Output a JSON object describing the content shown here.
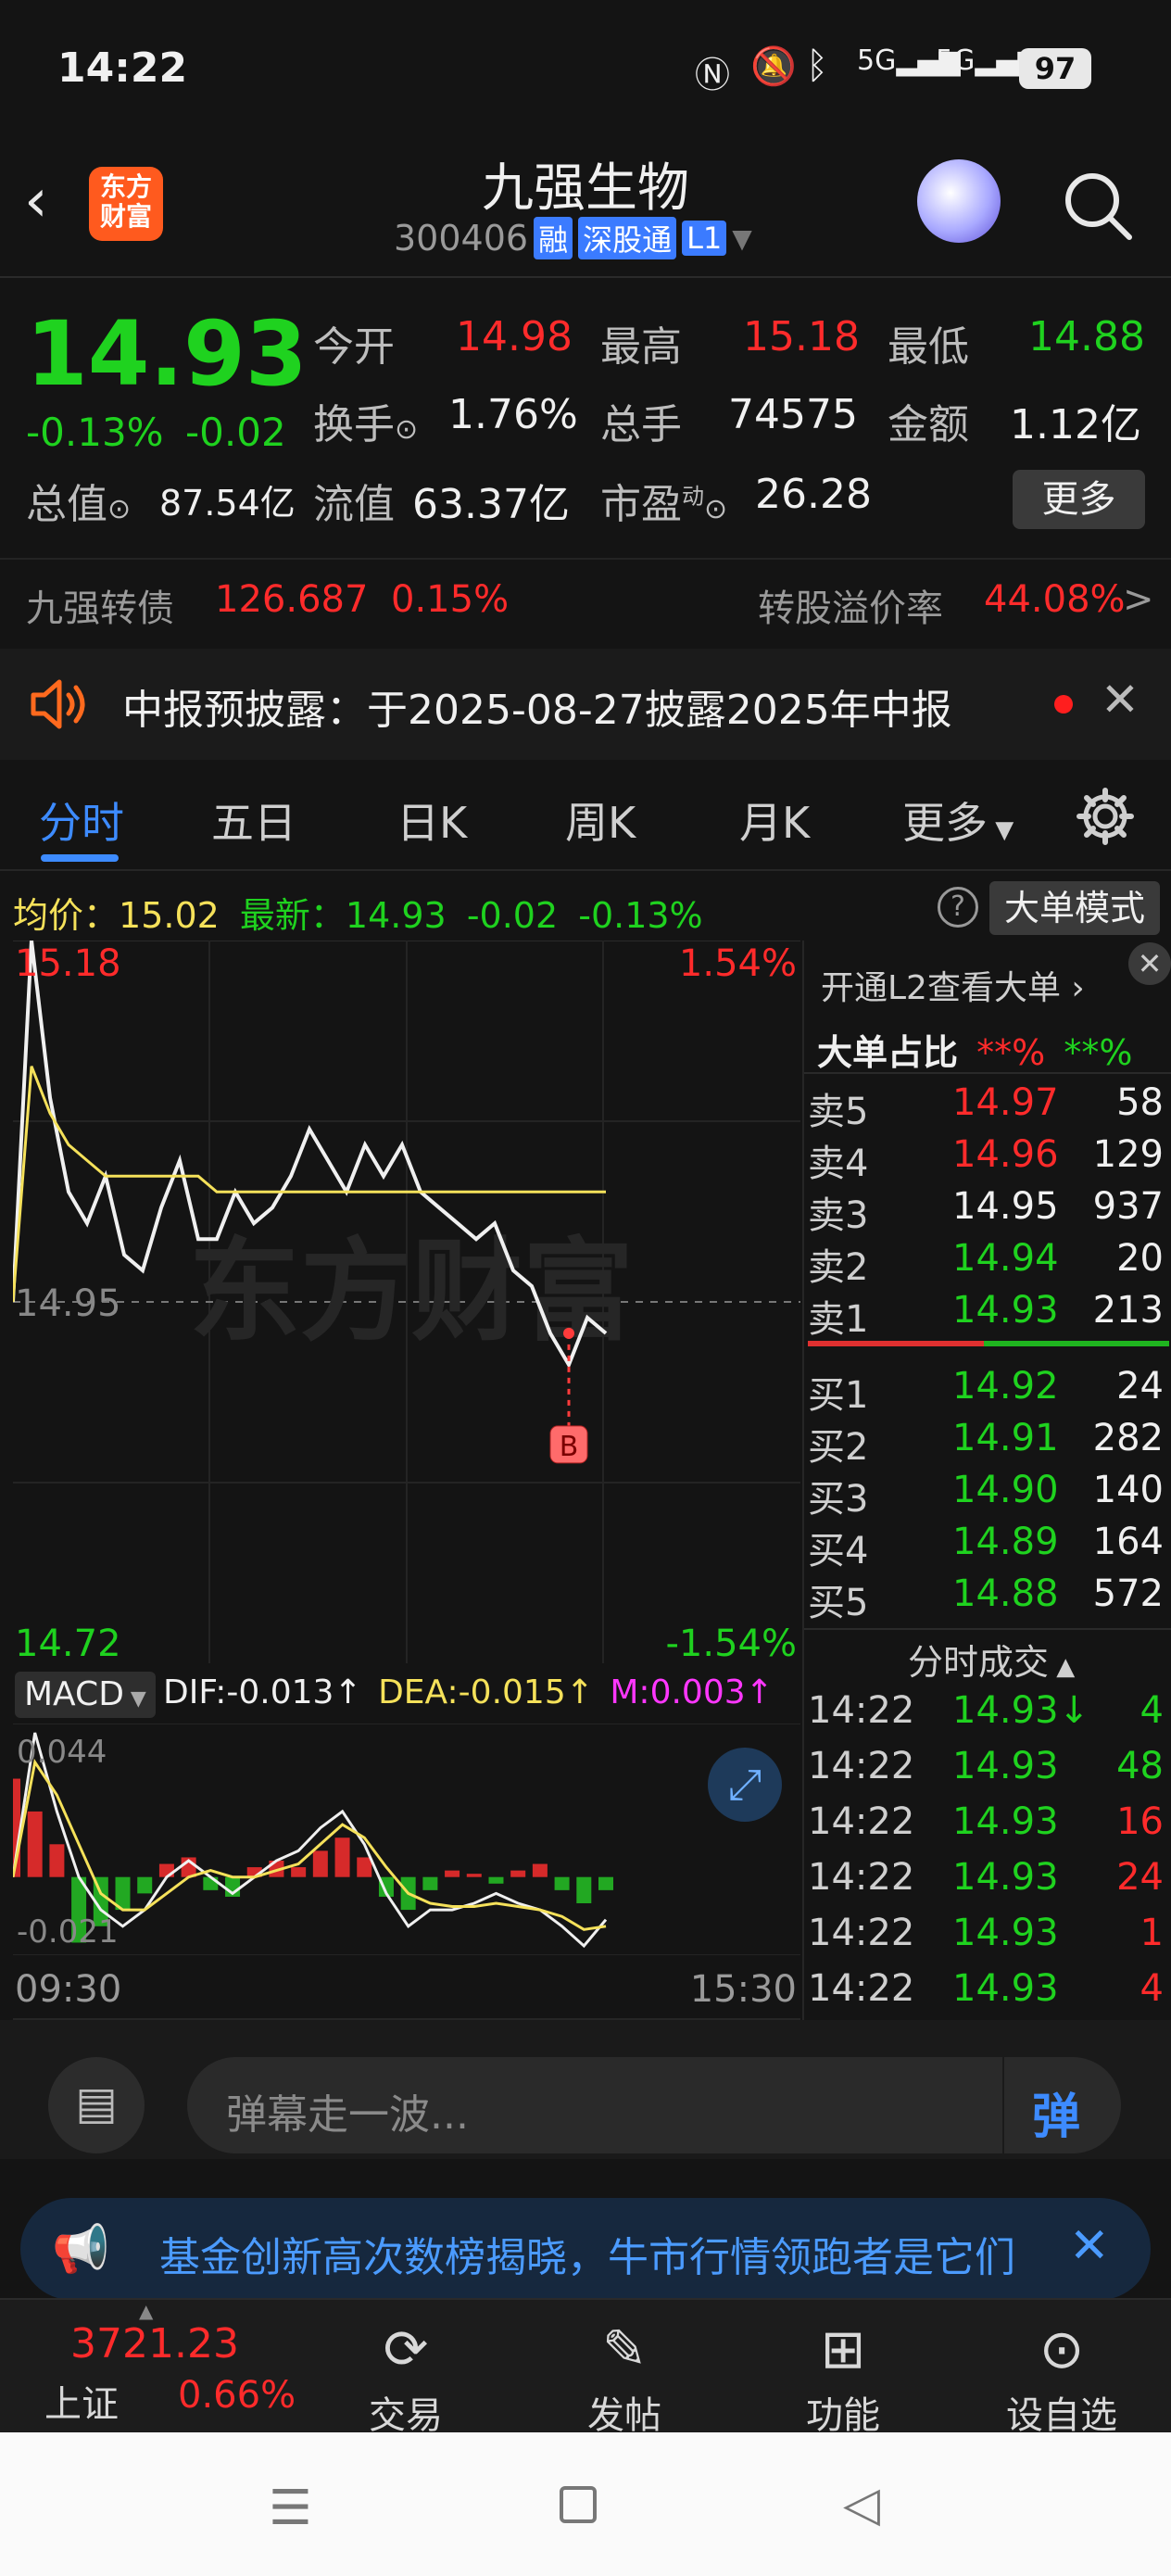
{
  "status": {
    "time": "14:22",
    "battery": "97",
    "net1": "5G",
    "net2": "5G"
  },
  "header": {
    "brand_line1": "东方",
    "brand_line2": "财富",
    "title": "九强生物",
    "code": "300406",
    "tag_rong": "融",
    "tag_connect": "深股通",
    "tag_level": "L1"
  },
  "quote": {
    "price": "14.93",
    "change_pct": "-0.13%",
    "change": "-0.02",
    "open_label": "今开",
    "open": "14.98",
    "high_label": "最高",
    "high": "15.18",
    "low_label": "最低",
    "low": "14.88",
    "turnover_label": "换手",
    "turnover": "1.76%",
    "volume_label": "总手",
    "volume": "74575",
    "amount_label": "金额",
    "amount": "1.12亿",
    "mktcap_label": "总值",
    "mktcap": "87.54亿",
    "float_label": "流值",
    "float": "63.37亿",
    "pe_label": "市盈",
    "pe_sup": "动",
    "pe": "26.28",
    "more": "更多"
  },
  "bond": {
    "name": "九强转债",
    "price": "126.687",
    "pct": "0.15%",
    "premium_label": "转股溢价率",
    "premium": "44.08%",
    "arrow": ">"
  },
  "notice": {
    "text": "中报预披露：于2025-08-27披露2025年中报"
  },
  "tabs": [
    {
      "label": "分时"
    },
    {
      "label": "五日"
    },
    {
      "label": "日K"
    },
    {
      "label": "周K"
    },
    {
      "label": "月K"
    },
    {
      "label": "更多"
    }
  ],
  "infobar": {
    "avg_label": "均价：",
    "avg": "15.02",
    "latest_label": "最新：",
    "latest": "14.93",
    "chg": "-0.02",
    "pct": "-0.13%",
    "bigorder": "大单模式"
  },
  "chart_data": [
    {
      "type": "line",
      "title": "",
      "x": [
        "09:30",
        "15:30"
      ],
      "y_range": [
        14.72,
        15.18
      ],
      "pct_range": [
        "-1.54%",
        "1.54%"
      ],
      "reference": 14.95,
      "series": [
        {
          "name": "最新",
          "color": "#f0f0f0",
          "values": [
            14.95,
            15.18,
            15.08,
            15.02,
            15.0,
            15.03,
            14.98,
            14.97,
            15.01,
            15.04,
            14.99,
            14.99,
            15.02,
            15.0,
            15.01,
            15.03,
            15.06,
            15.04,
            15.02,
            15.05,
            15.03,
            15.05,
            15.02,
            15.01,
            15.0,
            14.99,
            15.0,
            14.97,
            14.96,
            14.93,
            14.91,
            14.94,
            14.93
          ]
        },
        {
          "name": "均价",
          "color": "#f5e15a",
          "values": [
            14.95,
            15.1,
            15.07,
            15.05,
            15.04,
            15.03,
            15.03,
            15.03,
            15.03,
            15.03,
            15.03,
            15.02,
            15.02,
            15.02,
            15.02,
            15.02,
            15.02,
            15.02,
            15.02,
            15.02,
            15.02,
            15.02,
            15.02,
            15.02,
            15.02,
            15.02,
            15.02,
            15.02,
            15.02,
            15.02,
            15.02,
            15.02,
            15.02
          ]
        }
      ],
      "annotations": [
        {
          "label": "B",
          "value": 14.93
        }
      ],
      "top_left": "15.18",
      "top_right": "1.54%",
      "mid_left": "14.95",
      "bottom_left": "14.72",
      "bottom_right": "-1.54%",
      "x_start": "09:30",
      "x_end": "15:30"
    },
    {
      "type": "bar",
      "title": "",
      "indicator": "MACD",
      "dif": "-0.013",
      "dea": "-0.015",
      "m": "0.003",
      "y_range": [
        -0.021,
        0.044
      ],
      "top_label": "0.044",
      "bottom_label": "-0.021",
      "histogram": [
        0.03,
        0.02,
        0.01,
        -0.02,
        -0.015,
        -0.01,
        -0.005,
        0.004,
        0.006,
        -0.004,
        -0.006,
        0.003,
        0.005,
        0.003,
        0.008,
        0.012,
        0.006,
        -0.006,
        -0.01,
        -0.004,
        0.002,
        0.001,
        -0.002,
        0.002,
        0.004,
        -0.004,
        -0.008,
        -0.004
      ],
      "dif_values": [
        0.0,
        0.044,
        0.02,
        0.0,
        -0.01,
        -0.015,
        -0.01,
        0.0,
        0.005,
        0.0,
        -0.005,
        0.0,
        0.005,
        0.008,
        0.015,
        0.02,
        0.01,
        -0.005,
        -0.015,
        -0.01,
        -0.01,
        -0.008,
        -0.005,
        -0.008,
        -0.01,
        -0.015,
        -0.021,
        -0.013
      ],
      "dea_values": [
        0.0,
        0.035,
        0.025,
        0.01,
        -0.005,
        -0.01,
        -0.01,
        -0.005,
        0.0,
        0.002,
        0.0,
        0.0,
        0.002,
        0.004,
        0.01,
        0.016,
        0.012,
        0.003,
        -0.005,
        -0.008,
        -0.009,
        -0.009,
        -0.008,
        -0.009,
        -0.01,
        -0.012,
        -0.016,
        -0.015
      ]
    }
  ],
  "macd": {
    "name": "MACD",
    "dif_label": "DIF:",
    "dif": "-0.013",
    "dea_label": "DEA:",
    "dea": "-0.015",
    "m_label": "M:",
    "m": "0.003",
    "top": "0.044",
    "bottom": "-0.021",
    "x_start": "09:30",
    "x_end": "15:30"
  },
  "side": {
    "promo": "开通L2查看大单",
    "bigratio_label": "大单占比",
    "bigratio_sell": "**%",
    "bigratio_buy": "**%",
    "sells": [
      {
        "label": "卖5",
        "price": "14.97",
        "vol": "58",
        "color": "red"
      },
      {
        "label": "卖4",
        "price": "14.96",
        "vol": "129",
        "color": "red"
      },
      {
        "label": "卖3",
        "price": "14.95",
        "vol": "937",
        "color": "white"
      },
      {
        "label": "卖2",
        "price": "14.94",
        "vol": "20",
        "color": "green"
      },
      {
        "label": "卖1",
        "price": "14.93",
        "vol": "213",
        "color": "green"
      }
    ],
    "buys": [
      {
        "label": "买1",
        "price": "14.92",
        "vol": "24",
        "color": "green"
      },
      {
        "label": "买2",
        "price": "14.91",
        "vol": "282",
        "color": "green"
      },
      {
        "label": "买3",
        "price": "14.90",
        "vol": "140",
        "color": "green"
      },
      {
        "label": "买4",
        "price": "14.89",
        "vol": "164",
        "color": "green"
      },
      {
        "label": "买5",
        "price": "14.88",
        "vol": "572",
        "color": "green"
      }
    ],
    "trades_title": "分时成交",
    "trades": [
      {
        "time": "14:22",
        "price": "14.93",
        "arrow": "↓",
        "vol": "4",
        "color": "green"
      },
      {
        "time": "14:22",
        "price": "14.93",
        "arrow": "",
        "vol": "48",
        "color": "green"
      },
      {
        "time": "14:22",
        "price": "14.93",
        "arrow": "",
        "vol": "16",
        "color": "red"
      },
      {
        "time": "14:22",
        "price": "14.93",
        "arrow": "",
        "vol": "24",
        "color": "red"
      },
      {
        "time": "14:22",
        "price": "14.93",
        "arrow": "",
        "vol": "1",
        "color": "red"
      },
      {
        "time": "14:22",
        "price": "14.93",
        "arrow": "",
        "vol": "4",
        "color": "red"
      }
    ]
  },
  "comment": {
    "placeholder": "弹幕走一波...",
    "send": "弹"
  },
  "banner": {
    "text": "基金创新高次数榜揭晓，牛市行情领跑者是它们"
  },
  "bottomnav": {
    "index_value": "3721.23",
    "index_name": "上证",
    "index_pct": "0.66%",
    "items": [
      {
        "label": "交易"
      },
      {
        "label": "发帖"
      },
      {
        "label": "功能"
      },
      {
        "label": "设自选"
      }
    ]
  },
  "watermark": "东方财富"
}
